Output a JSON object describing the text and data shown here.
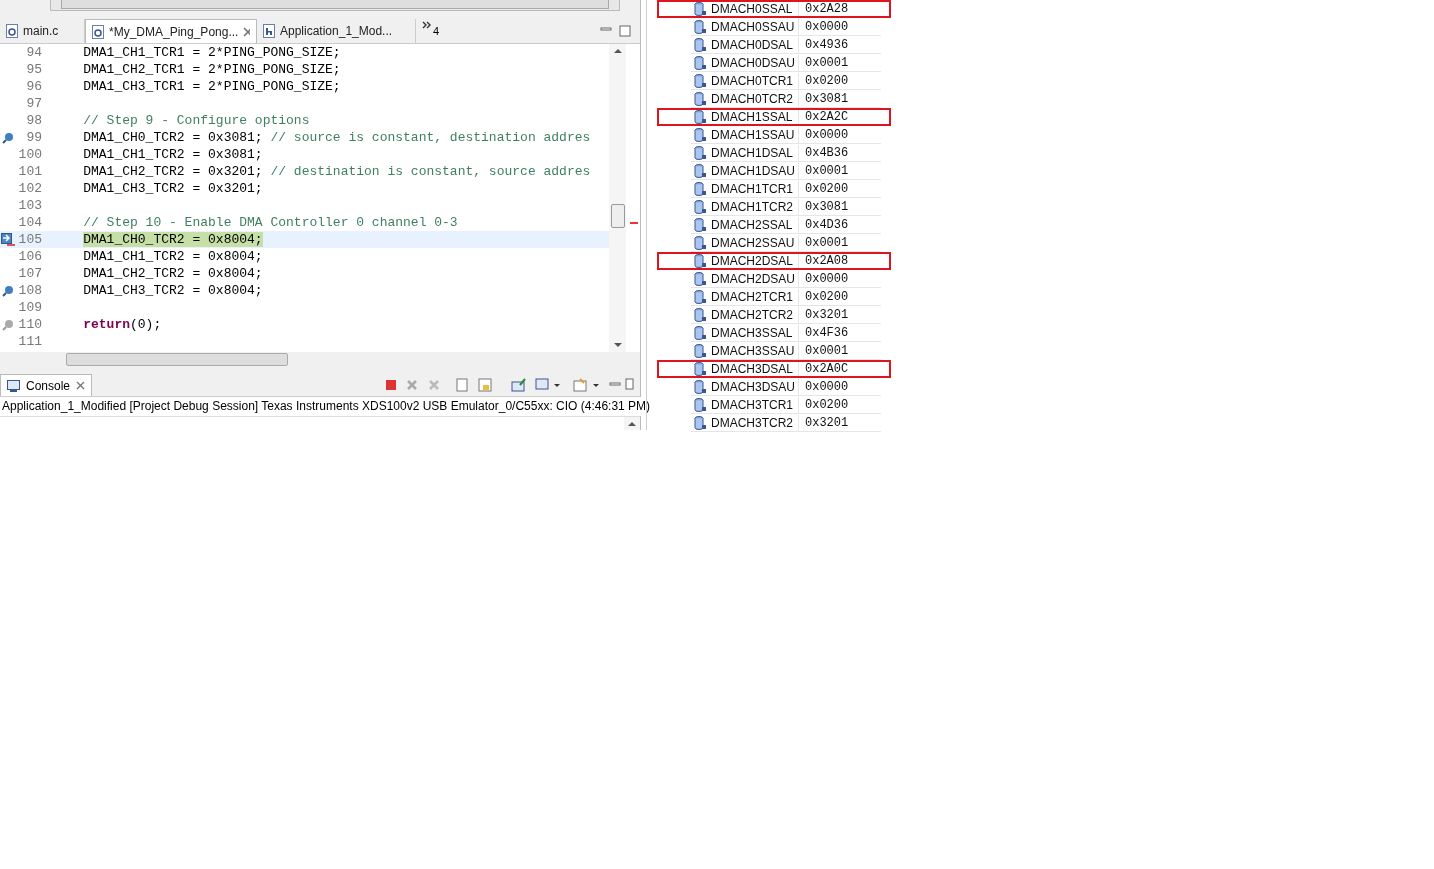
{
  "editor": {
    "tabs": [
      {
        "label": "main.c",
        "kind": "c-file",
        "selected": false
      },
      {
        "label": "*My_DMA_Ping_Pong...",
        "kind": "c-file",
        "selected": true
      },
      {
        "label": "Application_1_Mod...",
        "kind": "h-file",
        "selected": false
      }
    ],
    "overflow_count": "4",
    "lines": [
      {
        "number": "94",
        "current": false,
        "segments": [
          {
            "kind": "code",
            "text": "DMA1_CH1_TCR1 = 2*PING_PONG_SIZE;"
          }
        ]
      },
      {
        "number": "95",
        "current": false,
        "segments": [
          {
            "kind": "code",
            "text": "DMA1_CH2_TCR1 = 2*PING_PONG_SIZE;"
          }
        ]
      },
      {
        "number": "96",
        "current": false,
        "segments": [
          {
            "kind": "code",
            "text": "DMA1_CH3_TCR1 = 2*PING_PONG_SIZE;"
          }
        ]
      },
      {
        "number": "97",
        "current": false
      },
      {
        "number": "98",
        "current": false,
        "segments": [
          {
            "kind": "comment",
            "text": "// Step 9 - Configure options"
          }
        ]
      },
      {
        "number": "99",
        "kind": "breakpoint",
        "current": false,
        "segments": [
          {
            "kind": "code",
            "text": "DMA1_CH0_TCR2 = 0x3081; "
          },
          {
            "kind": "comment",
            "text": "// source is constant, destination addres"
          }
        ]
      },
      {
        "number": "100",
        "current": false,
        "segments": [
          {
            "kind": "code",
            "text": "DMA1_CH1_TCR2 = 0x3081;"
          }
        ]
      },
      {
        "number": "101",
        "current": false,
        "segments": [
          {
            "kind": "code",
            "text": "DMA1_CH2_TCR2 = 0x3201; "
          },
          {
            "kind": "comment",
            "text": "// destination is constant, source addres"
          }
        ]
      },
      {
        "number": "102",
        "current": false,
        "segments": [
          {
            "kind": "code",
            "text": "DMA1_CH3_TCR2 = 0x3201;"
          }
        ]
      },
      {
        "number": "103",
        "current": false
      },
      {
        "number": "104",
        "current": false,
        "segments": [
          {
            "kind": "comment",
            "text": "// Step 10 - Enable DMA Controller 0 channel 0-3"
          }
        ]
      },
      {
        "number": "105",
        "kind": "program-counter",
        "current": true,
        "segments": [
          {
            "kind": "code",
            "text": "DMA1_CH0_TCR2 = 0x8004;"
          }
        ]
      },
      {
        "number": "106",
        "current": false,
        "segments": [
          {
            "kind": "code",
            "text": "DMA1_CH1_TCR2 = 0x8004;"
          }
        ]
      },
      {
        "number": "107",
        "current": false,
        "segments": [
          {
            "kind": "code",
            "text": "DMA1_CH2_TCR2 = 0x8004;"
          }
        ]
      },
      {
        "number": "108",
        "kind": "breakpoint",
        "current": false,
        "segments": [
          {
            "kind": "code",
            "text": "DMA1_CH3_TCR2 = 0x8004;"
          }
        ]
      },
      {
        "number": "109",
        "current": false
      },
      {
        "number": "110",
        "kind": "breakpoint-disabled",
        "current": false,
        "segments": [
          {
            "kind": "keyword",
            "text": "return"
          },
          {
            "kind": "code",
            "text": "(0);"
          }
        ]
      },
      {
        "number": "111",
        "current": false
      }
    ]
  },
  "console": {
    "title": "Console",
    "session": "Application_1_Modified [Project Debug Session] Texas Instruments XDS100v2 USB Emulator_0/C55xx: CIO (4:46:31 PM)"
  },
  "registers": [
    {
      "name": "DMACH0SSAL",
      "value": "0x2A28",
      "highlighted": true
    },
    {
      "name": "DMACH0SSAU",
      "value": "0x0000",
      "highlighted": false
    },
    {
      "name": "DMACH0DSAL",
      "value": "0x4936",
      "highlighted": false
    },
    {
      "name": "DMACH0DSAU",
      "value": "0x0001",
      "highlighted": false
    },
    {
      "name": "DMACH0TCR1",
      "value": "0x0200",
      "highlighted": false
    },
    {
      "name": "DMACH0TCR2",
      "value": "0x3081",
      "highlighted": false
    },
    {
      "name": "DMACH1SSAL",
      "value": "0x2A2C",
      "highlighted": true
    },
    {
      "name": "DMACH1SSAU",
      "value": "0x0000",
      "highlighted": false
    },
    {
      "name": "DMACH1DSAL",
      "value": "0x4B36",
      "highlighted": false
    },
    {
      "name": "DMACH1DSAU",
      "value": "0x0001",
      "highlighted": false
    },
    {
      "name": "DMACH1TCR1",
      "value": "0x0200",
      "highlighted": false
    },
    {
      "name": "DMACH1TCR2",
      "value": "0x3081",
      "highlighted": false
    },
    {
      "name": "DMACH2SSAL",
      "value": "0x4D36",
      "highlighted": false
    },
    {
      "name": "DMACH2SSAU",
      "value": "0x0001",
      "highlighted": false
    },
    {
      "name": "DMACH2DSAL",
      "value": "0x2A08",
      "highlighted": true
    },
    {
      "name": "DMACH2DSAU",
      "value": "0x0000",
      "highlighted": false
    },
    {
      "name": "DMACH2TCR1",
      "value": "0x0200",
      "highlighted": false
    },
    {
      "name": "DMACH2TCR2",
      "value": "0x3201",
      "highlighted": false
    },
    {
      "name": "DMACH3SSAL",
      "value": "0x4F36",
      "highlighted": false
    },
    {
      "name": "DMACH3SSAU",
      "value": "0x0001",
      "highlighted": false
    },
    {
      "name": "DMACH3DSAL",
      "value": "0x2A0C",
      "highlighted": true
    },
    {
      "name": "DMACH3DSAU",
      "value": "0x0000",
      "highlighted": false
    },
    {
      "name": "DMACH3TCR1",
      "value": "0x0200",
      "highlighted": false
    },
    {
      "name": "DMACH3TCR2",
      "value": "0x3201",
      "highlighted": false
    }
  ]
}
